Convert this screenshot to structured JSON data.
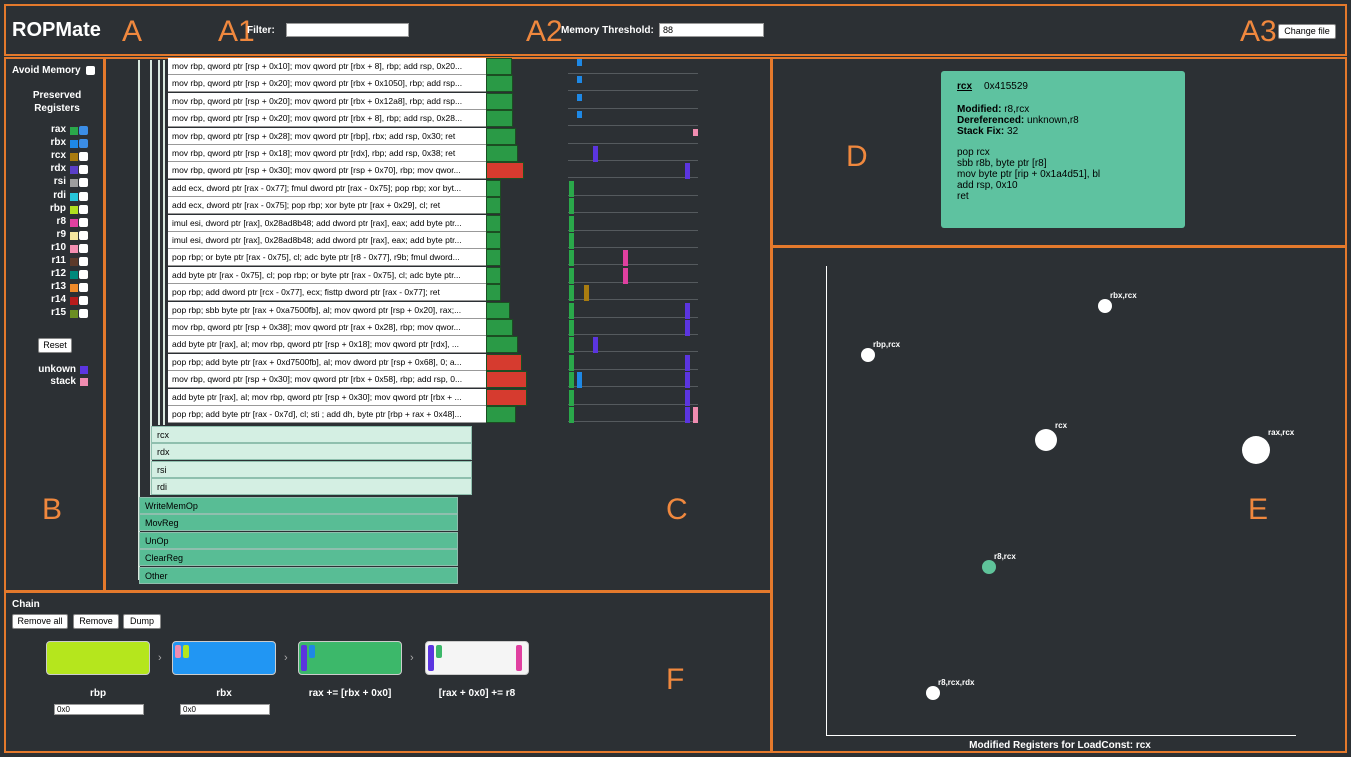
{
  "header": {
    "app_title": "ROPMate",
    "marker_a": "A",
    "marker_a1": "A1",
    "marker_a2": "A2",
    "marker_a3": "A3",
    "filter_label": "Filter:",
    "filter_value": "",
    "memory_threshold_label": "Memory Threshold:",
    "memory_threshold_value": "88",
    "change_file_label": "Change file"
  },
  "sidebar": {
    "marker": "B",
    "avoid_memory_label": "Avoid Memory",
    "preserved_label": "Preserved Registers",
    "registers": [
      {
        "name": "rax",
        "color": "#2aa84a",
        "checked": true
      },
      {
        "name": "rbx",
        "color": "#1e88e5",
        "checked": true
      },
      {
        "name": "rcx",
        "color": "#a97c10",
        "checked": false
      },
      {
        "name": "rdx",
        "color": "#5a3fc8",
        "checked": false
      },
      {
        "name": "rsi",
        "color": "#9e9e9e",
        "checked": false
      },
      {
        "name": "rdi",
        "color": "#26c6da",
        "checked": false
      },
      {
        "name": "rbp",
        "color": "#b0e020",
        "checked": false
      },
      {
        "name": "r8",
        "color": "#e040a0",
        "checked": false
      },
      {
        "name": "r9",
        "color": "#f5e6a0",
        "checked": false
      },
      {
        "name": "r10",
        "color": "#f48fb1",
        "checked": false
      },
      {
        "name": "r11",
        "color": "#5d3a2a",
        "checked": false
      },
      {
        "name": "r12",
        "color": "#00897b",
        "checked": false
      },
      {
        "name": "r13",
        "color": "#ef8a2a",
        "checked": false
      },
      {
        "name": "r14",
        "color": "#b71c1c",
        "checked": false
      },
      {
        "name": "r15",
        "color": "#6b8e23",
        "checked": false
      }
    ],
    "reset_label": "Reset",
    "legend": [
      {
        "label": "unkown",
        "color": "#5b35e0"
      },
      {
        "label": "stack",
        "color": "#f08cb0"
      }
    ]
  },
  "gadgets": {
    "marker": "C",
    "rows": [
      {
        "text": "mov rbp, qword ptr [rsp + 0x10]; mov qword ptr [rbx + 8], rbp; add rsp, 0x20...",
        "bar_color": "#2a9a46",
        "bar_len": 0.3
      },
      {
        "text": "mov rbp, qword ptr [rsp + 0x20]; mov qword ptr [rbx + 0x1050], rbp; add rsp...",
        "bar_color": "#2a9a46",
        "bar_len": 0.32
      },
      {
        "text": "mov rbp, qword ptr [rsp + 0x20]; mov qword ptr [rbx + 0x12a8], rbp; add rsp...",
        "bar_color": "#2a9a46",
        "bar_len": 0.32
      },
      {
        "text": "mov rbp, qword ptr [rsp + 0x20]; mov qword ptr [rbx + 8], rbp; add rsp, 0x28...",
        "bar_color": "#2a9a46",
        "bar_len": 0.32
      },
      {
        "text": "mov rbp, qword ptr [rsp + 0x28]; mov qword ptr [rbp], rbx; add rsp, 0x30; ret",
        "bar_color": "#2a9a46",
        "bar_len": 0.35
      },
      {
        "text": "mov rbp, qword ptr [rsp + 0x18]; mov qword ptr [rdx], rbp; add rsp, 0x38; ret",
        "bar_color": "#2a9a46",
        "bar_len": 0.38
      },
      {
        "text": "mov rbp, qword ptr [rsp + 0x30]; mov qword ptr [rsp + 0x70], rbp; mov qwor...",
        "bar_color": "#d63b2f",
        "bar_len": 0.45
      },
      {
        "text": "add ecx, dword ptr [rax - 0x77]; fmul dword ptr [rax - 0x75]; pop rbp; xor byt...",
        "bar_color": "#2a9a46",
        "bar_len": 0.18
      },
      {
        "text": "add ecx, dword ptr [rax - 0x75]; pop rbp; xor byte ptr [rax + 0x29], cl; ret",
        "bar_color": "#2a9a46",
        "bar_len": 0.18
      },
      {
        "text": "imul esi, dword ptr [rax], 0x28ad8b48; add dword ptr [rax], eax; add byte ptr...",
        "bar_color": "#2a9a46",
        "bar_len": 0.18
      },
      {
        "text": "imul esi, dword ptr [rax], 0x28ad8b48; add dword ptr [rax], eax; add byte ptr...",
        "bar_color": "#2a9a46",
        "bar_len": 0.18
      },
      {
        "text": "pop rbp; or byte ptr [rax - 0x75], cl; adc byte ptr [r8 - 0x77], r9b; fmul dword...",
        "bar_color": "#2a9a46",
        "bar_len": 0.18
      },
      {
        "text": "add byte ptr [rax - 0x75], cl; pop rbp; or byte ptr [rax - 0x75], cl; adc byte ptr...",
        "bar_color": "#2a9a46",
        "bar_len": 0.18
      },
      {
        "text": "pop rbp; add dword ptr [rcx - 0x77], ecx; fisttp dword ptr [rax - 0x77]; ret",
        "bar_color": "#2a9a46",
        "bar_len": 0.18
      },
      {
        "text": "pop rbp; sbb byte ptr [rax + 0xa7500fb], al; mov qword ptr [rsp + 0x20], rax;...",
        "bar_color": "#2a9a46",
        "bar_len": 0.28
      },
      {
        "text": "mov rbp, qword ptr [rsp + 0x38]; mov qword ptr [rax + 0x28], rbp; mov qwor...",
        "bar_color": "#2a9a46",
        "bar_len": 0.32
      },
      {
        "text": "add byte ptr [rax], al; mov rbp, qword ptr [rsp + 0x18]; mov qword ptr [rdx], ...",
        "bar_color": "#2a9a46",
        "bar_len": 0.38
      },
      {
        "text": "pop rbp; add byte ptr [rax + 0xd7500fb], al; mov dword ptr [rsp + 0x68], 0; a...",
        "bar_color": "#d63b2f",
        "bar_len": 0.42
      },
      {
        "text": "mov rbp, qword ptr [rsp + 0x30]; mov qword ptr [rbx + 0x58], rbp; add rsp, 0...",
        "bar_color": "#d63b2f",
        "bar_len": 0.48
      },
      {
        "text": "add byte ptr [rax], al; mov rbp, qword ptr [rsp + 0x30]; mov qword ptr [rbx + ...",
        "bar_color": "#d63b2f",
        "bar_len": 0.48
      },
      {
        "text": "pop rbp; add byte ptr [rax - 0x7d], cl; sti ; add dh, byte ptr [rbp + rax + 0x48]...",
        "bar_color": "#2a9a46",
        "bar_len": 0.35
      }
    ],
    "reg_groups": [
      "rcx",
      "rdx",
      "rsi",
      "rdi"
    ],
    "categories": [
      "WriteMemOp",
      "MovReg",
      "UnOp",
      "ClearReg",
      "Other"
    ]
  },
  "detail": {
    "marker": "D",
    "register": "rcx",
    "address": "0x415529",
    "modified_label": "Modified:",
    "modified_value": "r8,rcx",
    "dereferenced_label": "Dereferenced:",
    "dereferenced_value": "unknown,r8",
    "stackfix_label": "Stack Fix:",
    "stackfix_value": "32",
    "instructions": [
      "pop rcx",
      "sbb r8b, byte ptr [r8]",
      "mov byte ptr [rip + 0x1a4d51], bl",
      "add rsp, 0x10",
      "ret"
    ]
  },
  "scatter": {
    "marker": "E",
    "xlabel": "Modified Registers for LoadConst: rcx",
    "points": [
      {
        "label": "rbx,rcx",
        "color": "#ffffff",
        "size": 1
      },
      {
        "label": "rbp,rcx",
        "color": "#ffffff",
        "size": 1
      },
      {
        "label": "rcx",
        "color": "#ffffff",
        "size": 2
      },
      {
        "label": "rax,rcx",
        "color": "#ffffff",
        "size": 3
      },
      {
        "label": "r8,rcx",
        "color": "#5fc39a",
        "size": 1
      },
      {
        "label": "r8,rcx,rdx",
        "color": "#ffffff",
        "size": 1
      }
    ]
  },
  "chain": {
    "marker": "F",
    "title": "Chain",
    "remove_all_label": "Remove all",
    "remove_label": "Remove",
    "dump_label": "Dump",
    "items": [
      {
        "label": "rbp",
        "color": "#b5e61d",
        "value": "0x0"
      },
      {
        "label": "rbx",
        "color": "#2196f3",
        "value": "0x0"
      },
      {
        "label": "rax += [rbx + 0x0]",
        "color": "#3cb86a",
        "value": ""
      },
      {
        "label": "[rax + 0x0] += r8",
        "color": "#f5f5f5",
        "value": ""
      }
    ]
  }
}
